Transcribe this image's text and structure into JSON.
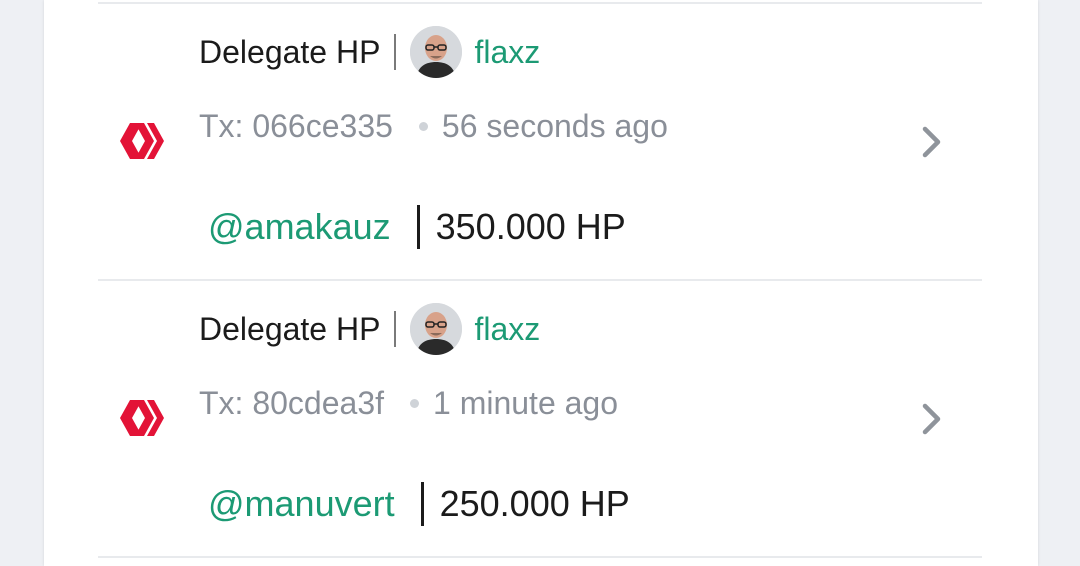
{
  "transactions": [
    {
      "operation": "Delegate HP",
      "user": "flaxz",
      "tx_label": "Tx: 066ce335",
      "time": "56 seconds ago",
      "recipient": "@amakauz",
      "amount": "350.000 HP"
    },
    {
      "operation": "Delegate HP",
      "user": "flaxz",
      "tx_label": "Tx: 80cdea3f",
      "time": "1 minute ago",
      "recipient": "@manuvert",
      "amount": "250.000 HP"
    }
  ],
  "icons": {
    "chain": "hive-logo-icon",
    "open": "chevron-right-icon",
    "avatar": "user-avatar"
  },
  "colors": {
    "accent": "#1c9a74",
    "hive_red": "#e31337",
    "muted_text": "#8a8f98"
  }
}
